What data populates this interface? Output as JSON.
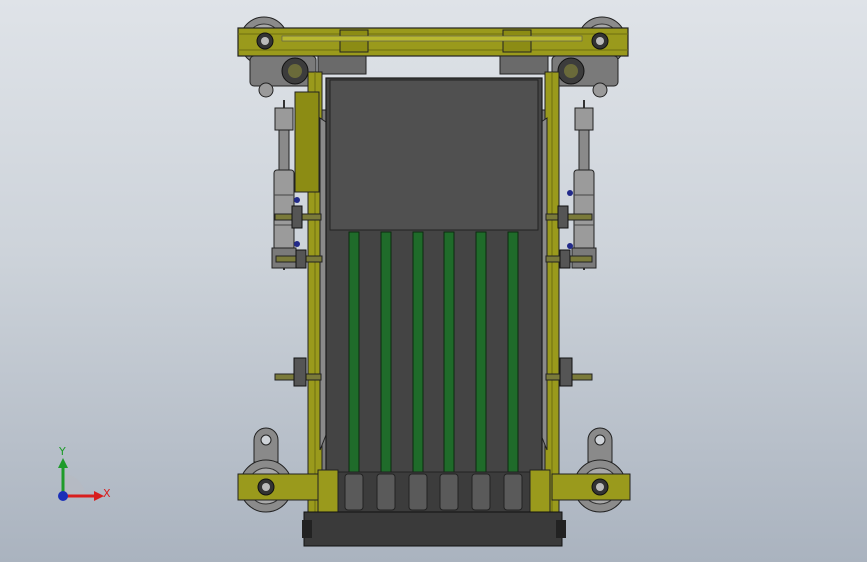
{
  "triad": {
    "y_label": "Y",
    "x_label": "X",
    "y_color": "#1e9b2a",
    "x_color": "#d81e1e",
    "z_color": "#1a2fb8"
  },
  "colors": {
    "frame": "#9a9a1c",
    "frame_dark": "#6e6e10",
    "belt": "#444444",
    "strip": "#1f6b2a",
    "wheel": "#8a8a8a",
    "steel": "#9a9a9a",
    "bolt": "#222a8a"
  },
  "belt_strips": 6
}
